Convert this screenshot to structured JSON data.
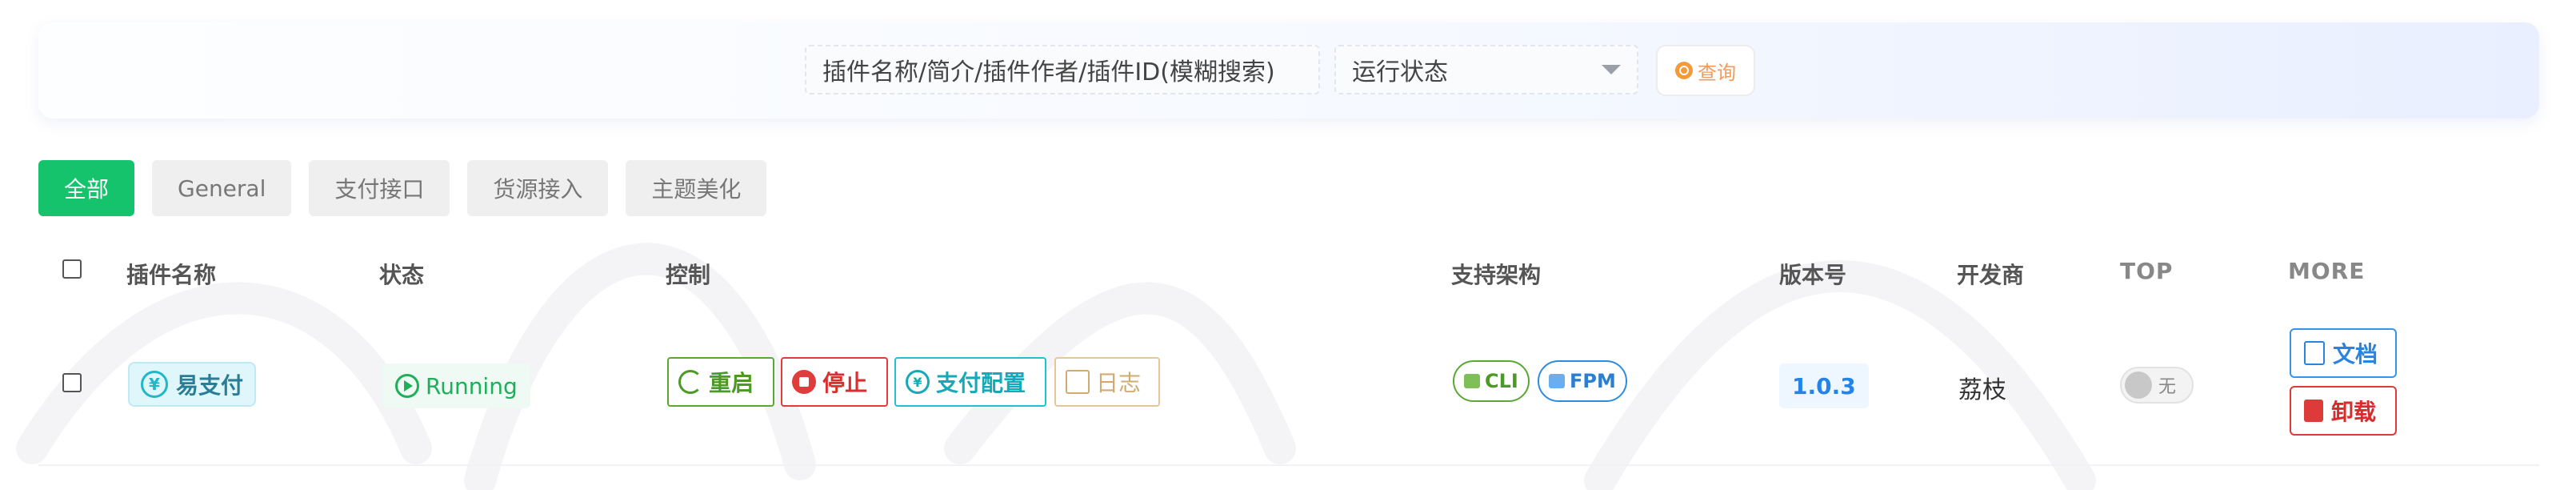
{
  "search": {
    "keyword_placeholder": "插件名称/简介/插件作者/插件ID(模糊搜索)",
    "status_select": "运行状态",
    "query_button": "查询"
  },
  "tabs": [
    "全部",
    "General",
    "支付接口",
    "货源接入",
    "主题美化"
  ],
  "table": {
    "headers": {
      "name": "插件名称",
      "status": "状态",
      "control": "控制",
      "arch": "支持架构",
      "version": "版本号",
      "developer": "开发商",
      "top": "TOP",
      "more": "MORE"
    },
    "rows": [
      {
        "name": "易支付",
        "status": "Running",
        "controls": {
          "restart": "重启",
          "stop": "停止",
          "pay_config": "支付配置",
          "log": "日志"
        },
        "arch": [
          "CLI",
          "FPM"
        ],
        "version": "1.0.3",
        "developer": "荔枝",
        "top": "无",
        "more": {
          "doc": "文档",
          "uninstall": "卸载"
        }
      }
    ]
  },
  "colors": {
    "accent_green": "#14c36b",
    "running_green": "#1fae5a",
    "stop_red": "#e03c3c",
    "pay_cyan": "#22c1cf",
    "doc_blue": "#3a93e6",
    "query_orange": "#f29a58"
  },
  "icons": {
    "query": "search-icon",
    "status": "play-circle-icon",
    "restart": "refresh-icon",
    "stop": "stop-icon",
    "pay": "yen-icon",
    "log": "log-icon",
    "doc": "document-icon",
    "uninstall": "trash-icon"
  }
}
